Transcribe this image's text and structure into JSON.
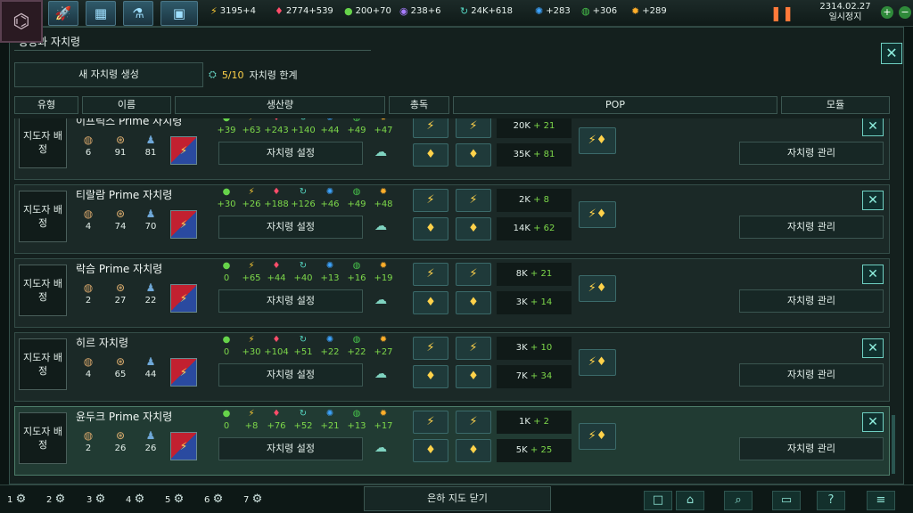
{
  "header": {
    "emblem": "faction-emblem",
    "top_icons": [
      "ship",
      "galaxy-map",
      "research"
    ],
    "resources": [
      {
        "icon": "⚡",
        "color": "#ffcc33",
        "value": "3195+4"
      },
      {
        "icon": "♦",
        "color": "#ff4d6a",
        "value": "2774+539"
      },
      {
        "icon": "●",
        "color": "#66d34a",
        "value": "200+70"
      },
      {
        "icon": "◉",
        "color": "#a77bff",
        "value": "238+6"
      },
      {
        "icon": "↻",
        "color": "#55d6c2",
        "value": "24K+618"
      },
      {
        "icon": "✺",
        "color": "#3da4ff",
        "value": "+283"
      },
      {
        "icon": "◍",
        "color": "#47c24a",
        "value": "+306"
      },
      {
        "icon": "✹",
        "color": "#ffae2a",
        "value": "+289"
      }
    ],
    "date": "2314.02.27",
    "pause_status": "일시정지"
  },
  "window": {
    "title": "행성과 자치령",
    "new_colony": "새 자치령 생성",
    "limit_count": "5/10",
    "limit_label": "자치령 한계",
    "columns": [
      "유형",
      "이름",
      "생산량",
      "총독",
      "POP",
      "모듈"
    ]
  },
  "resource_icons": [
    {
      "icon": "●",
      "color": "#66d34a"
    },
    {
      "icon": "⚡",
      "color": "#ffcc33"
    },
    {
      "icon": "♦",
      "color": "#ff4d6a"
    },
    {
      "icon": "↻",
      "color": "#55d6c2"
    },
    {
      "icon": "✺",
      "color": "#3da4ff"
    },
    {
      "icon": "◍",
      "color": "#47c24a"
    },
    {
      "icon": "✹",
      "color": "#ffae2a"
    }
  ],
  "rows": [
    {
      "name": "이프릭스 Prime 자치령",
      "gov": "지도자 배정",
      "planets": "6",
      "systems": "91",
      "pops": "81",
      "prod": [
        "+39",
        "+63",
        "+243",
        "+140",
        "+44",
        "+49",
        "+47"
      ],
      "settings": "자치령 설정",
      "manage": "자치령 관리",
      "pop1_base": "20K",
      "pop1_plus": "+ 21",
      "pop2_base": "35K",
      "pop2_plus": "+ 81",
      "highlight": false
    },
    {
      "name": "티랄람 Prime 자치령",
      "gov": "지도자 배정",
      "planets": "4",
      "systems": "74",
      "pops": "70",
      "prod": [
        "+30",
        "+26",
        "+188",
        "+126",
        "+46",
        "+49",
        "+48"
      ],
      "settings": "자치령 설정",
      "manage": "자치령 관리",
      "pop1_base": "2K",
      "pop1_plus": "+ 8",
      "pop2_base": "14K",
      "pop2_plus": "+ 62",
      "highlight": false
    },
    {
      "name": "락슴 Prime 자치령",
      "gov": "지도자 배정",
      "planets": "2",
      "systems": "27",
      "pops": "22",
      "prod": [
        "0",
        "+65",
        "+44",
        "+40",
        "+13",
        "+16",
        "+19"
      ],
      "settings": "자치령 설정",
      "manage": "자치령 관리",
      "pop1_base": "8K",
      "pop1_plus": "+ 21",
      "pop2_base": "3K",
      "pop2_plus": "+ 14",
      "highlight": false
    },
    {
      "name": "히르 자치령",
      "gov": "지도자 배정",
      "planets": "4",
      "systems": "65",
      "pops": "44",
      "prod": [
        "0",
        "+30",
        "+104",
        "+51",
        "+22",
        "+22",
        "+27"
      ],
      "settings": "자치령 설정",
      "manage": "자치령 관리",
      "pop1_base": "3K",
      "pop1_plus": "+ 10",
      "pop2_base": "7K",
      "pop2_plus": "+ 34",
      "highlight": false
    },
    {
      "name": "윤두크 Prime 자치령",
      "gov": "지도자 배정",
      "planets": "2",
      "systems": "26",
      "pops": "26",
      "prod": [
        "0",
        "+8",
        "+76",
        "+52",
        "+21",
        "+13",
        "+17"
      ],
      "settings": "자치령 설정",
      "manage": "자치령 관리",
      "pop1_base": "1K",
      "pop1_plus": "+ 2",
      "pop2_base": "5K",
      "pop2_plus": "+ 25",
      "highlight": true
    }
  ],
  "bottom": {
    "slots": [
      "1",
      "2",
      "3",
      "4",
      "5",
      "6",
      "7"
    ],
    "close_map": "은하 지도 닫기"
  }
}
